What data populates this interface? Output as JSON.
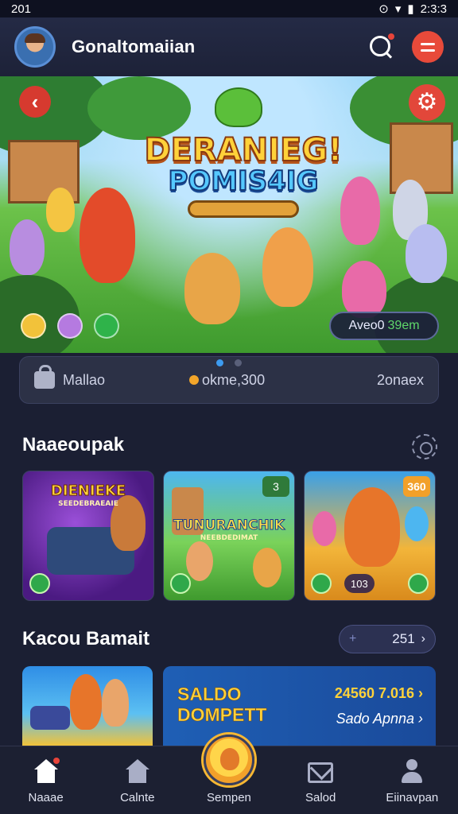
{
  "status_bar": {
    "left": "201",
    "time": "2:3:3"
  },
  "header": {
    "title": "Gonaltomaiian"
  },
  "hero": {
    "logo_line1": "DERANIEG!",
    "logo_line2": "POMIS4IG",
    "pill_prefix": "Aveo0",
    "pill_value": "39em"
  },
  "carousel": {
    "page_count": 2,
    "active_index": 0
  },
  "info_bar": {
    "left": "Mallao",
    "middle": "okme,300",
    "right": "2onaex"
  },
  "section1": {
    "title": "Naaeoupak",
    "cards": [
      {
        "title": "DIENIEKE",
        "subtitle": "SEEDEBRAEAIE",
        "badge": "",
        "stat": ""
      },
      {
        "title": "TUNURANCHIK",
        "subtitle": "NEEBDEDIMAT",
        "badge": "3",
        "stat": ""
      },
      {
        "title": "",
        "subtitle": "",
        "badge": "360",
        "stat": "103"
      }
    ]
  },
  "section2": {
    "title": "Kacou Bamait",
    "count": "251",
    "promo": {
      "headline_1": "SALDO",
      "headline_2": "DOMPETT",
      "right_1": "24560 7.016 ›",
      "right_2": "Sado Apnna ›"
    }
  },
  "bottom_nav": [
    {
      "label": "Naaae",
      "icon": "home-icon",
      "active": true
    },
    {
      "label": "Calnte",
      "icon": "shop-icon",
      "active": false
    },
    {
      "label": "Sempen",
      "icon": "mascot-coin-icon",
      "active": false
    },
    {
      "label": "Salod",
      "icon": "mail-icon",
      "active": false
    },
    {
      "label": "Eiinavpan",
      "icon": "user-icon",
      "active": false
    }
  ],
  "colors": {
    "accent_red": "#e84a3a",
    "accent_blue": "#3d9bf0",
    "background": "#1b1f33",
    "coin_gold": "#f2a52a"
  }
}
